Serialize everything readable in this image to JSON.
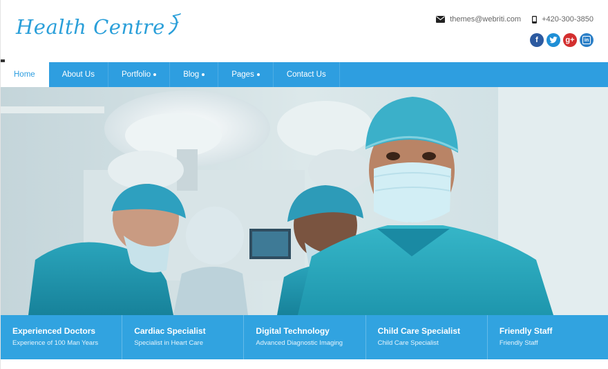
{
  "brand": {
    "name": "Health Centre",
    "color": "#2a9fd9"
  },
  "contact": {
    "email": "themes@webriti.com",
    "phone": "+420-300-3850"
  },
  "social": [
    {
      "icon": "facebook-icon",
      "glyph": "f"
    },
    {
      "icon": "twitter-icon",
      "glyph": "t"
    },
    {
      "icon": "google-plus-icon",
      "glyph": "g+"
    },
    {
      "icon": "linkedin-icon",
      "glyph": "in"
    }
  ],
  "nav": {
    "items": [
      {
        "label": "Home",
        "active": true,
        "dropdown": false
      },
      {
        "label": "About Us",
        "active": false,
        "dropdown": false
      },
      {
        "label": "Portfolio",
        "active": false,
        "dropdown": true
      },
      {
        "label": "Blog",
        "active": false,
        "dropdown": true
      },
      {
        "label": "Pages",
        "active": false,
        "dropdown": true
      },
      {
        "label": "Contact Us",
        "active": false,
        "dropdown": false
      }
    ]
  },
  "features": [
    {
      "title": "Experienced Doctors",
      "subtitle": "Experience of 100 Man Years"
    },
    {
      "title": "Cardiac Specialist",
      "subtitle": "Specialist in Heart Care"
    },
    {
      "title": "Digital Technology",
      "subtitle": "Advanced Diagnostic Imaging"
    },
    {
      "title": "Child Care Specialist",
      "subtitle": "Child Care Specialist"
    },
    {
      "title": "Friendly Staff",
      "subtitle": "Friendly Staff"
    }
  ],
  "colors": {
    "accent": "#2e9ee0",
    "strip": "#31a3e0"
  }
}
